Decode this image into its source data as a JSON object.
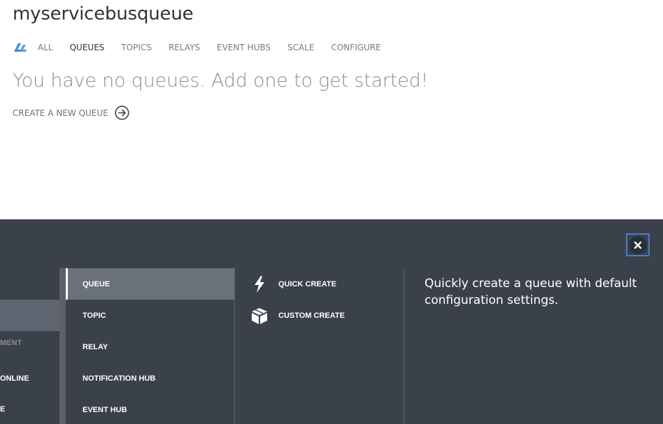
{
  "header": {
    "title": "myservicebusqueue"
  },
  "nav": {
    "logo_icon": "service-bus-icon",
    "tabs": [
      {
        "label": "ALL",
        "active": false
      },
      {
        "label": "QUEUES",
        "active": true
      },
      {
        "label": "TOPICS",
        "active": false
      },
      {
        "label": "RELAYS",
        "active": false
      },
      {
        "label": "EVENT HUBS",
        "active": false
      },
      {
        "label": "SCALE",
        "active": false
      },
      {
        "label": "CONFIGURE",
        "active": false
      }
    ]
  },
  "main": {
    "empty_message": "You have no queues. Add one to get started!",
    "create_link_label": "CREATE A NEW QUEUE",
    "create_link_icon": "arrow-right-circle-icon"
  },
  "drawer": {
    "close_icon": "close-icon",
    "col1": {
      "items": [
        "MENT",
        "ONLINE",
        "E"
      ]
    },
    "col2": {
      "items": [
        {
          "label": "QUEUE",
          "selected": true
        },
        {
          "label": "TOPIC",
          "selected": false
        },
        {
          "label": "RELAY",
          "selected": false
        },
        {
          "label": "NOTIFICATION HUB",
          "selected": false
        },
        {
          "label": "EVENT HUB",
          "selected": false
        }
      ]
    },
    "col3": {
      "items": [
        {
          "label": "QUICK CREATE",
          "icon": "lightning-icon"
        },
        {
          "label": "CUSTOM CREATE",
          "icon": "box-icon"
        }
      ]
    },
    "description": "Quickly create a queue with default configuration settings."
  },
  "colors": {
    "drawer_bg": "#3b414b",
    "selected_bg": "#6b717b",
    "close_border": "#4a7bd0",
    "logo_blue": "#3a8fd6"
  }
}
